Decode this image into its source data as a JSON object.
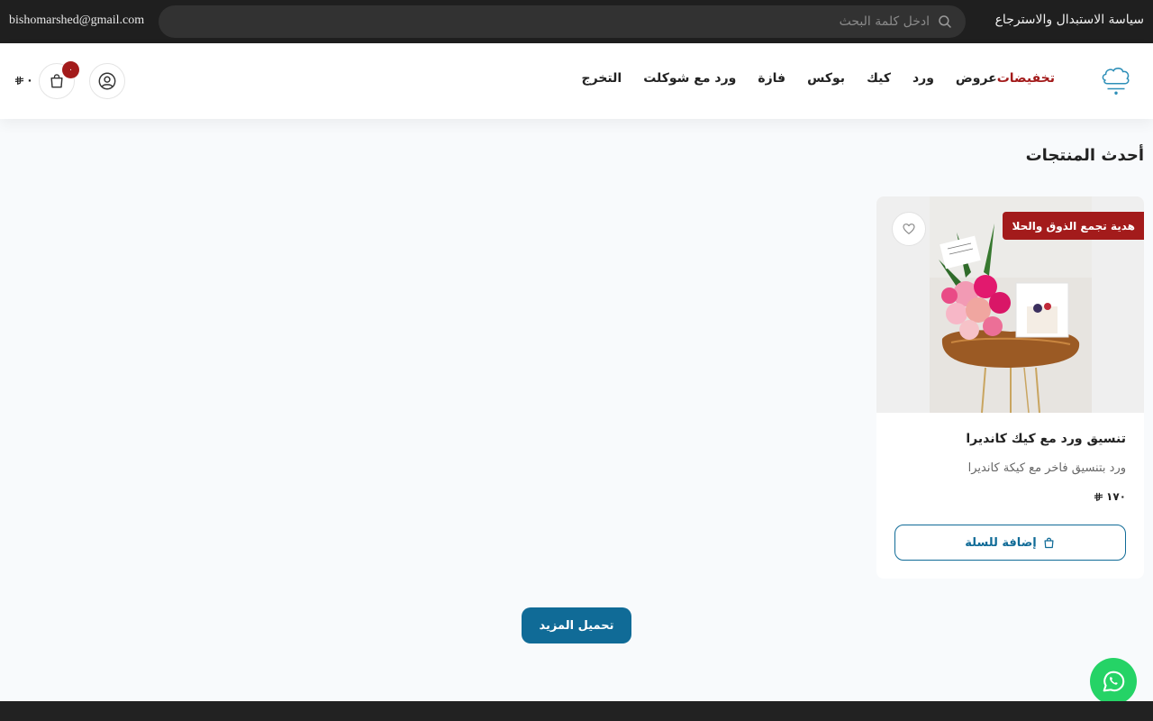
{
  "topbar": {
    "policy_link": "سياسة الاستبدال والاسترجاع",
    "email": "bishomarshed@gmail.com",
    "search_placeholder": "ادخل كلمة البحث"
  },
  "nav": {
    "items": [
      "تخفيضات",
      "عروض",
      "ورد",
      "كيك",
      "بوكس",
      "فازة",
      "ورد مع شوكلت",
      "التخرج"
    ]
  },
  "cart": {
    "count": "٠",
    "total": "٠"
  },
  "section": {
    "title": "أحدث المنتجات"
  },
  "product": {
    "badge": "هدية تجمع الذوق والحلا",
    "title": "تنسيق ورد مع كيك كانديرا",
    "description": "ورد بتنسيق فاخر مع كيكة كانديرا",
    "price": "١٧٠",
    "add_to_cart": "إضافة للسلة"
  },
  "load_more": "تحميل المزيد",
  "colors": {
    "topbar_bg": "#1f1f1f",
    "accent_red": "#a31b1b",
    "primary_blue": "#106b97",
    "whatsapp_green": "#25d366",
    "page_bg": "#f8fafc"
  },
  "icons": [
    "search-icon",
    "logo-icon",
    "user-icon",
    "shopping-bag-icon",
    "riyal-icon",
    "heart-icon",
    "whatsapp-icon"
  ]
}
